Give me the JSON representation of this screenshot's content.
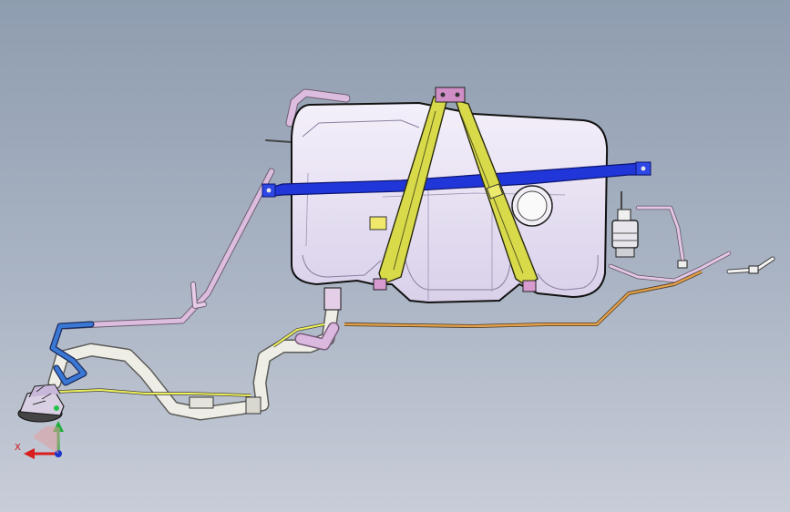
{
  "viewer": {
    "triad": {
      "x_label": "X",
      "colors": {
        "x": "#d81e1e",
        "y": "#1fae3a",
        "z": "#1b35c9"
      }
    }
  },
  "model": {
    "component_colors": {
      "tank": "#e9e3f3",
      "tank_edge": "#1a1a1a",
      "strap": "#d6d94a",
      "crossmember": "#1a2fd6",
      "vent_line": "#d9b9db",
      "filler_neck": "#ecece4",
      "brake_line": "#d9922e",
      "sender_hose": "#3a6fd0",
      "canister": "#e7e7ea"
    }
  }
}
